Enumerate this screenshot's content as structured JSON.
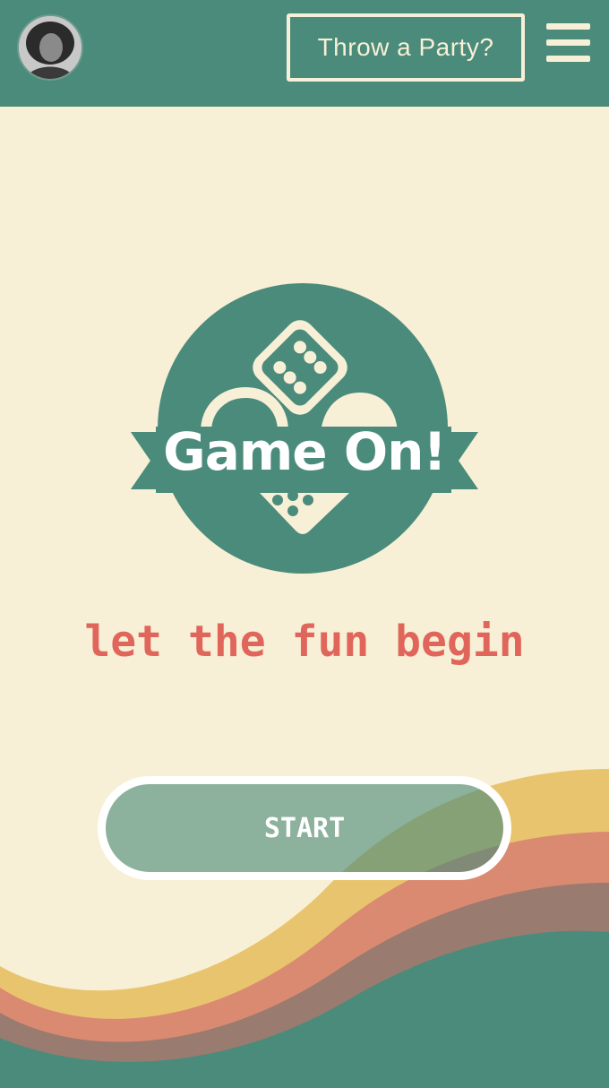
{
  "header": {
    "party_button_label": "Throw a Party?"
  },
  "logo": {
    "title": "Game On!"
  },
  "main": {
    "tagline": "let the fun begin",
    "start_label": "START"
  },
  "colors": {
    "teal": "#4a8b7b",
    "cream": "#f8f0d6",
    "coral": "#e0665c",
    "mustard": "#e9c46f",
    "salmon": "#db8a72",
    "mauve": "#9a7b6f"
  }
}
